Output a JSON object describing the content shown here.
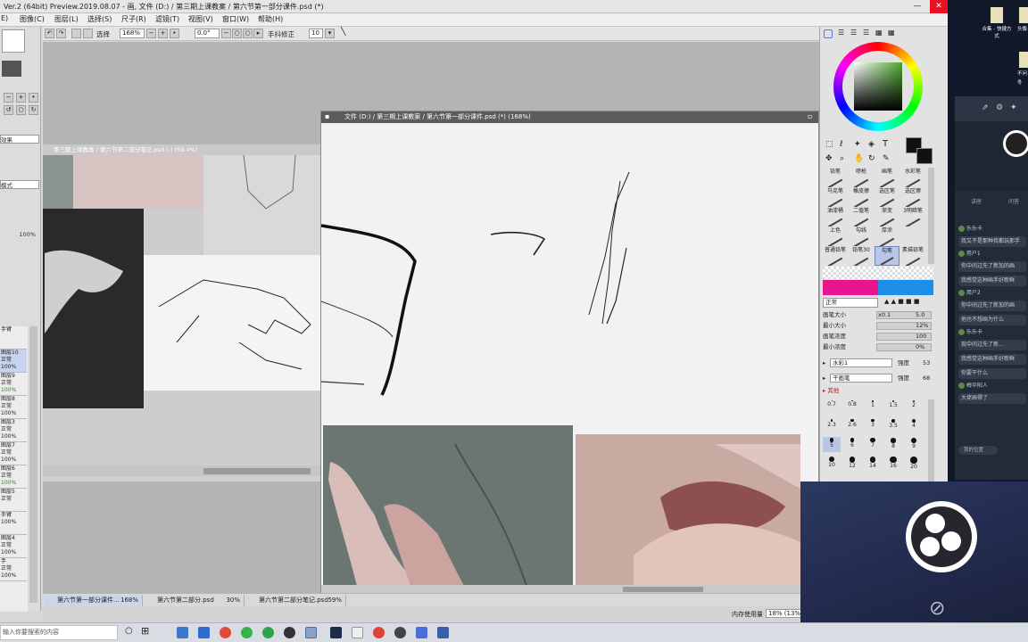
{
  "titlebar": {
    "title": "Ver.2 (64bit) Preview.2019.08.07 - 画, 文件 (D:) / 第三期上课教案 / 第六节第一部分课件.psd (*)",
    "minimize": "—",
    "close": "✕"
  },
  "menubar": {
    "items": [
      "E)",
      "图像(C)",
      "图层(L)",
      "选择(S)",
      "尺子(R)",
      "滤镜(T)",
      "视图(V)",
      "窗口(W)",
      "帮助(H)"
    ]
  },
  "toolbar": {
    "select_label": "选择",
    "zoom": "168%",
    "angle": "0.0°",
    "stabilizer_label": "手抖修正",
    "stabilizer_value": "10"
  },
  "left_panel": {
    "labels": [
      "效果",
      "模式",
      "100%"
    ],
    "layers": [
      {
        "name": "手臂",
        "mode": ""
      },
      {
        "name": "图层10",
        "mode": "正常",
        "opacity": "100%"
      },
      {
        "name": "图层9",
        "mode": "正常",
        "opacity": "100%"
      },
      {
        "name": "图层8",
        "mode": "正常",
        "opacity": "100%"
      },
      {
        "name": "图层3",
        "mode": "正常",
        "opacity": "100%"
      },
      {
        "name": "图层7",
        "mode": "正常",
        "opacity": "100%"
      },
      {
        "name": "图层6",
        "mode": "正常",
        "opacity": "100%"
      },
      {
        "name": "图层5",
        "mode": "正常",
        "opacity": ""
      },
      {
        "name": "手臂",
        "mode": "",
        "opacity": "100%"
      },
      {
        "name": "图层4",
        "mode": "正常",
        "opacity": "100%"
      },
      {
        "name": "手",
        "mode": "正常",
        "opacity": "100%"
      }
    ]
  },
  "canvas_windows": {
    "back_title": "第三期上课教案 / 第六节第二部分笔记.psd (-) (59.4%)",
    "front_title": "文件 (D:) / 第三期上课教案 / 第六节第一部分课件.psd (*) (168%)"
  },
  "doc_tabs": [
    {
      "name": "第六节第一部分课件...",
      "zoom": "168%"
    },
    {
      "name": "第六节第二部分.psd",
      "zoom": "30%"
    },
    {
      "name": "第六节第二部分笔记.psd",
      "zoom": "59%"
    }
  ],
  "status": {
    "memory_label": "内存使用量",
    "memory_value": "18% (13%)"
  },
  "right_panel": {
    "brushes": [
      "铅笔",
      "喷枪",
      "画笔",
      "水彩笔",
      "马克笔",
      "橡皮擦",
      "选区笔",
      "选区擦",
      "油漆桶",
      "二值笔",
      "渐变",
      "3明暗笔",
      "上色",
      "勾线",
      "厚涂",
      "",
      "普通铅笔",
      "铅笔30",
      "勾笔",
      "素描铅笔"
    ],
    "selected_brush": "勾笔",
    "blend_mode": "正常",
    "props": [
      {
        "label": "画笔大小",
        "mult": "x0.1",
        "value": "5.0"
      },
      {
        "label": "最小大小",
        "mult": "",
        "value": "12%"
      },
      {
        "label": "画笔浓度",
        "mult": "",
        "value": "100"
      },
      {
        "label": "最小浓度",
        "mult": "",
        "value": "0%"
      }
    ],
    "texture1": {
      "name": "水彩1",
      "label": "强度",
      "value": "53"
    },
    "texture2": {
      "name": "干画笔",
      "label": "强度",
      "value": "68"
    },
    "other_label": "其他",
    "sizes": [
      "0.7",
      "0.8",
      "1",
      "1.5",
      "2",
      "2.3",
      "2.6",
      "3",
      "3.5",
      "4",
      "5",
      "6",
      "7",
      "8",
      "9",
      "10",
      "12",
      "14",
      "16",
      "20"
    ],
    "selected_size": "5",
    "colors": {
      "primary": "#111111",
      "bar_left": "#e8158f",
      "bar_right": "#1e8fe8"
    }
  },
  "taskbar": {
    "search_placeholder": "输入你要搜索的内容"
  },
  "desktop": {
    "icons": [
      "合集 - 快捷方式",
      "头像",
      "不问",
      "冬"
    ],
    "chat_tabs": [
      "讲座",
      "问答"
    ],
    "messages": [
      {
        "user": "乐乐卡",
        "text": "我又不是那种我都玩那手"
      },
      {
        "user": "用户1",
        "text": "你中间过先了新加的画"
      },
      {
        "user": "",
        "text": "我感觉这种画手好新鲜"
      },
      {
        "user": "用户2",
        "text": "你中间过先了新加的画"
      },
      {
        "user": "",
        "text": "他也不想画为什么"
      },
      {
        "user": "乐乐卡",
        "text": "现中间过先了新..."
      },
      {
        "user": "",
        "text": "我感觉这种画手好新鲜"
      },
      {
        "user": "",
        "text": "你要干什么"
      },
      {
        "user": "梅华阳人",
        "text": "大佬画得了"
      }
    ],
    "input_placeholder": "我的位置"
  }
}
